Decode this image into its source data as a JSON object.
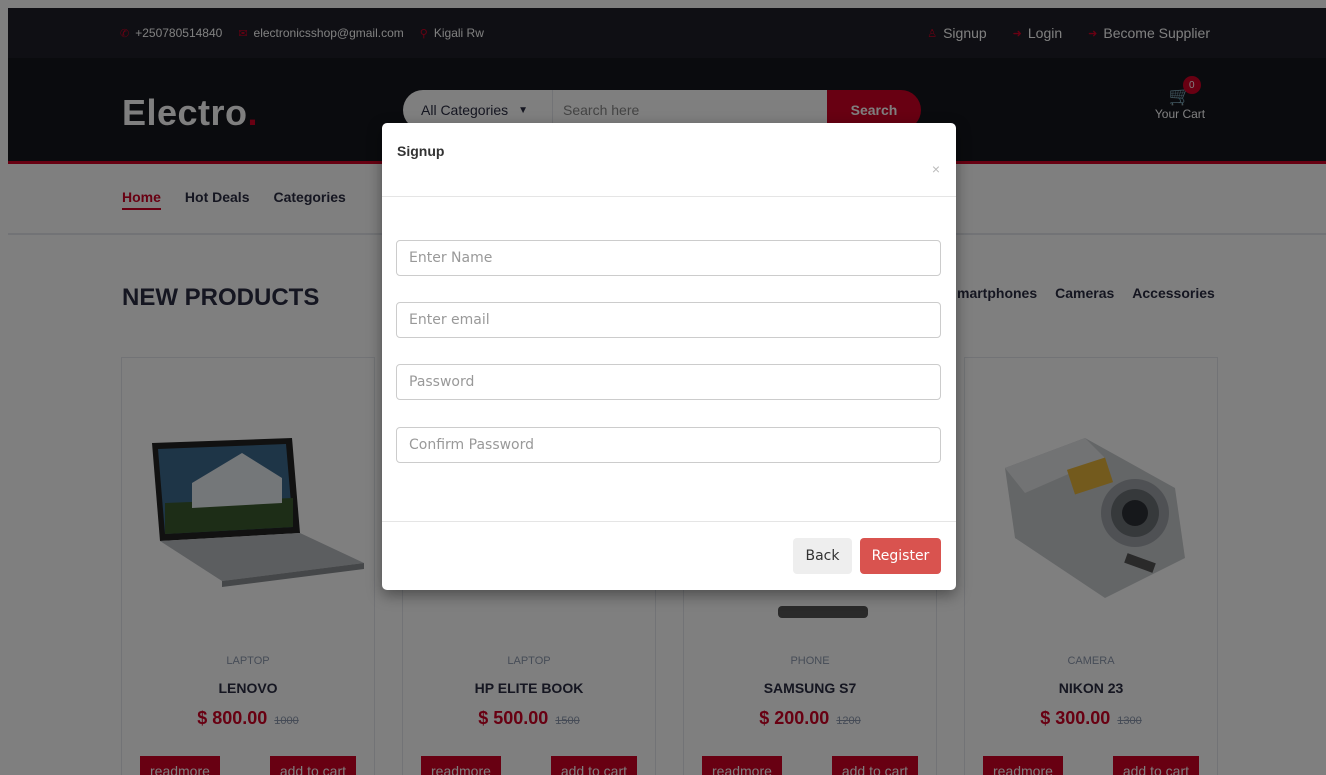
{
  "header": {
    "phone": "+250780514840",
    "email": "electronicsshop@gmail.com",
    "location": "Kigali Rw",
    "signup": "Signup",
    "login": "Login",
    "supplier": "Become Supplier"
  },
  "brand": {
    "name": "Electro",
    "dot": "."
  },
  "search": {
    "category": "All Categories",
    "placeholder": "Search here",
    "button": "Search"
  },
  "cart": {
    "label": "Your Cart",
    "count": "0"
  },
  "nav": {
    "items": [
      "Home",
      "Hot Deals",
      "Categories"
    ]
  },
  "section": {
    "title": "NEW PRODUCTS",
    "tabs": [
      "martphones",
      "Cameras",
      "Accessories"
    ]
  },
  "products": [
    {
      "category": "LAPTOP",
      "name": "LENOVO",
      "price": "$ 800.00",
      "old": "1000",
      "read": "readmore",
      "add": "add to cart"
    },
    {
      "category": "LAPTOP",
      "name": "HP ELITE BOOK",
      "price": "$ 500.00",
      "old": "1500",
      "read": "readmore",
      "add": "add to cart"
    },
    {
      "category": "PHONE",
      "name": "SAMSUNG S7",
      "price": "$ 200.00",
      "old": "1200",
      "read": "readmore",
      "add": "add to cart"
    },
    {
      "category": "CAMERA",
      "name": "NIKON 23",
      "price": "$ 300.00",
      "old": "1300",
      "read": "readmore",
      "add": "add to cart"
    }
  ],
  "modal": {
    "title": "Signup",
    "close": "×",
    "name_placeholder": "Enter Name",
    "email_placeholder": "Enter email",
    "password_placeholder": "Password",
    "confirm_placeholder": "Confirm Password",
    "back": "Back",
    "register": "Register"
  },
  "colors": {
    "accent": "#d10024",
    "dark": "#15161d",
    "register": "#d9534f"
  }
}
